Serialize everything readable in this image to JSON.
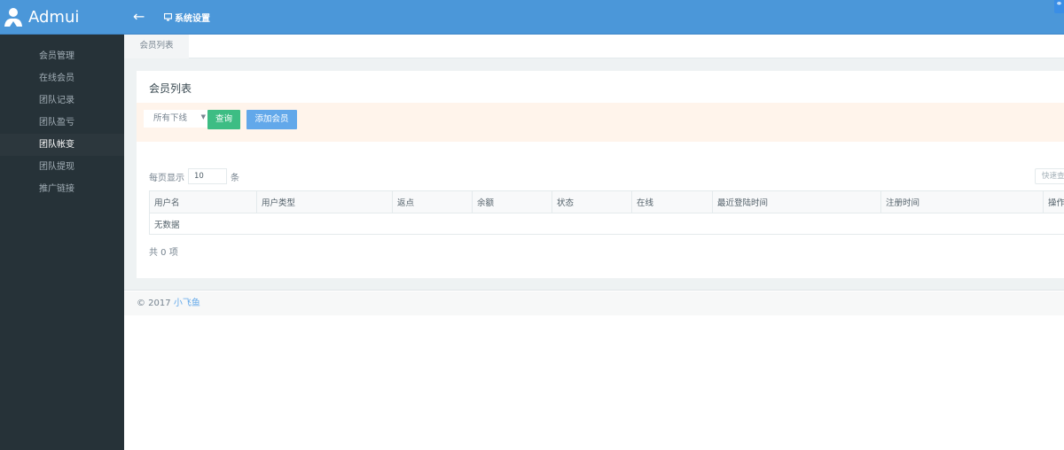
{
  "header": {
    "brand": "Admui",
    "breadcrumb": "系统设置",
    "back_icon": "arrow-left-icon",
    "monitor_icon": "monitor-icon",
    "corner_icon": "link-icon",
    "color": "#4b97d9"
  },
  "sidebar": {
    "items": [
      {
        "label": "会员管理"
      },
      {
        "label": "在线会员"
      },
      {
        "label": "团队记录"
      },
      {
        "label": "团队盈亏"
      },
      {
        "label": "团队帐变",
        "active": true
      },
      {
        "label": "团队提现"
      },
      {
        "label": "推广链接"
      }
    ]
  },
  "tabs": [
    {
      "label": "会员列表",
      "active": true
    }
  ],
  "panel": {
    "title": "会员列表",
    "filter": {
      "select_value": "所有下线",
      "query_label": "查询",
      "add_label": "添加会员"
    },
    "per_page_prefix": "每页显示",
    "per_page_value": "10",
    "per_page_suffix": "条",
    "search_placeholder": "快速查询",
    "table": {
      "headers": [
        "用户名",
        "用户类型",
        "返点",
        "余额",
        "状态",
        "在线",
        "最近登陆时间",
        "注册时间",
        "操作"
      ],
      "empty_text": "无数据"
    },
    "total": "共 0 项"
  },
  "footer": {
    "copyright": "© 2017",
    "link": "小飞鱼"
  },
  "colors": {
    "success": "#3dbd84",
    "primary": "#62a8ea",
    "sidebar": "#263238",
    "band": "#fff4eb"
  }
}
